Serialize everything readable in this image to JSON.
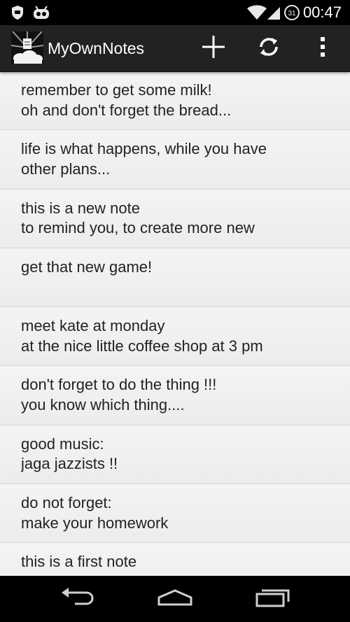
{
  "status_bar": {
    "time": "00:47",
    "icons": [
      "shield-icon",
      "cyanogen-bugdroid-icon",
      "wifi-icon",
      "cell-signal-icon",
      "battery-icon"
    ]
  },
  "action_bar": {
    "title": "MyOwnNotes",
    "actions": [
      "add-note",
      "sync",
      "overflow-menu"
    ]
  },
  "notes": [
    {
      "line1": "remember to get some milk!",
      "line2": "oh and don't forget the bread..."
    },
    {
      "line1": "life is what happens, while you have",
      "line2": "other plans..."
    },
    {
      "line1": "this is a new note",
      "line2": "to remind you, to create more new"
    },
    {
      "line1": "get that new game!",
      "line2": ""
    },
    {
      "line1": "meet kate at monday",
      "line2": "at the nice little coffee shop at 3 pm"
    },
    {
      "line1": "don't forget to do the thing !!!",
      "line2": "you know which thing...."
    },
    {
      "line1": "good music:",
      "line2": "jaga jazzists !!"
    },
    {
      "line1": "do not forget:",
      "line2": "make your homework"
    },
    {
      "line1": "this is a first note",
      "line2": ""
    }
  ],
  "nav_bar": {
    "buttons": [
      "back",
      "home",
      "recent-apps"
    ]
  },
  "colors": {
    "action_bar_bg": "#222222",
    "list_bg": "#f2f2f2",
    "divider": "#d6d6d6",
    "text": "#222222"
  }
}
